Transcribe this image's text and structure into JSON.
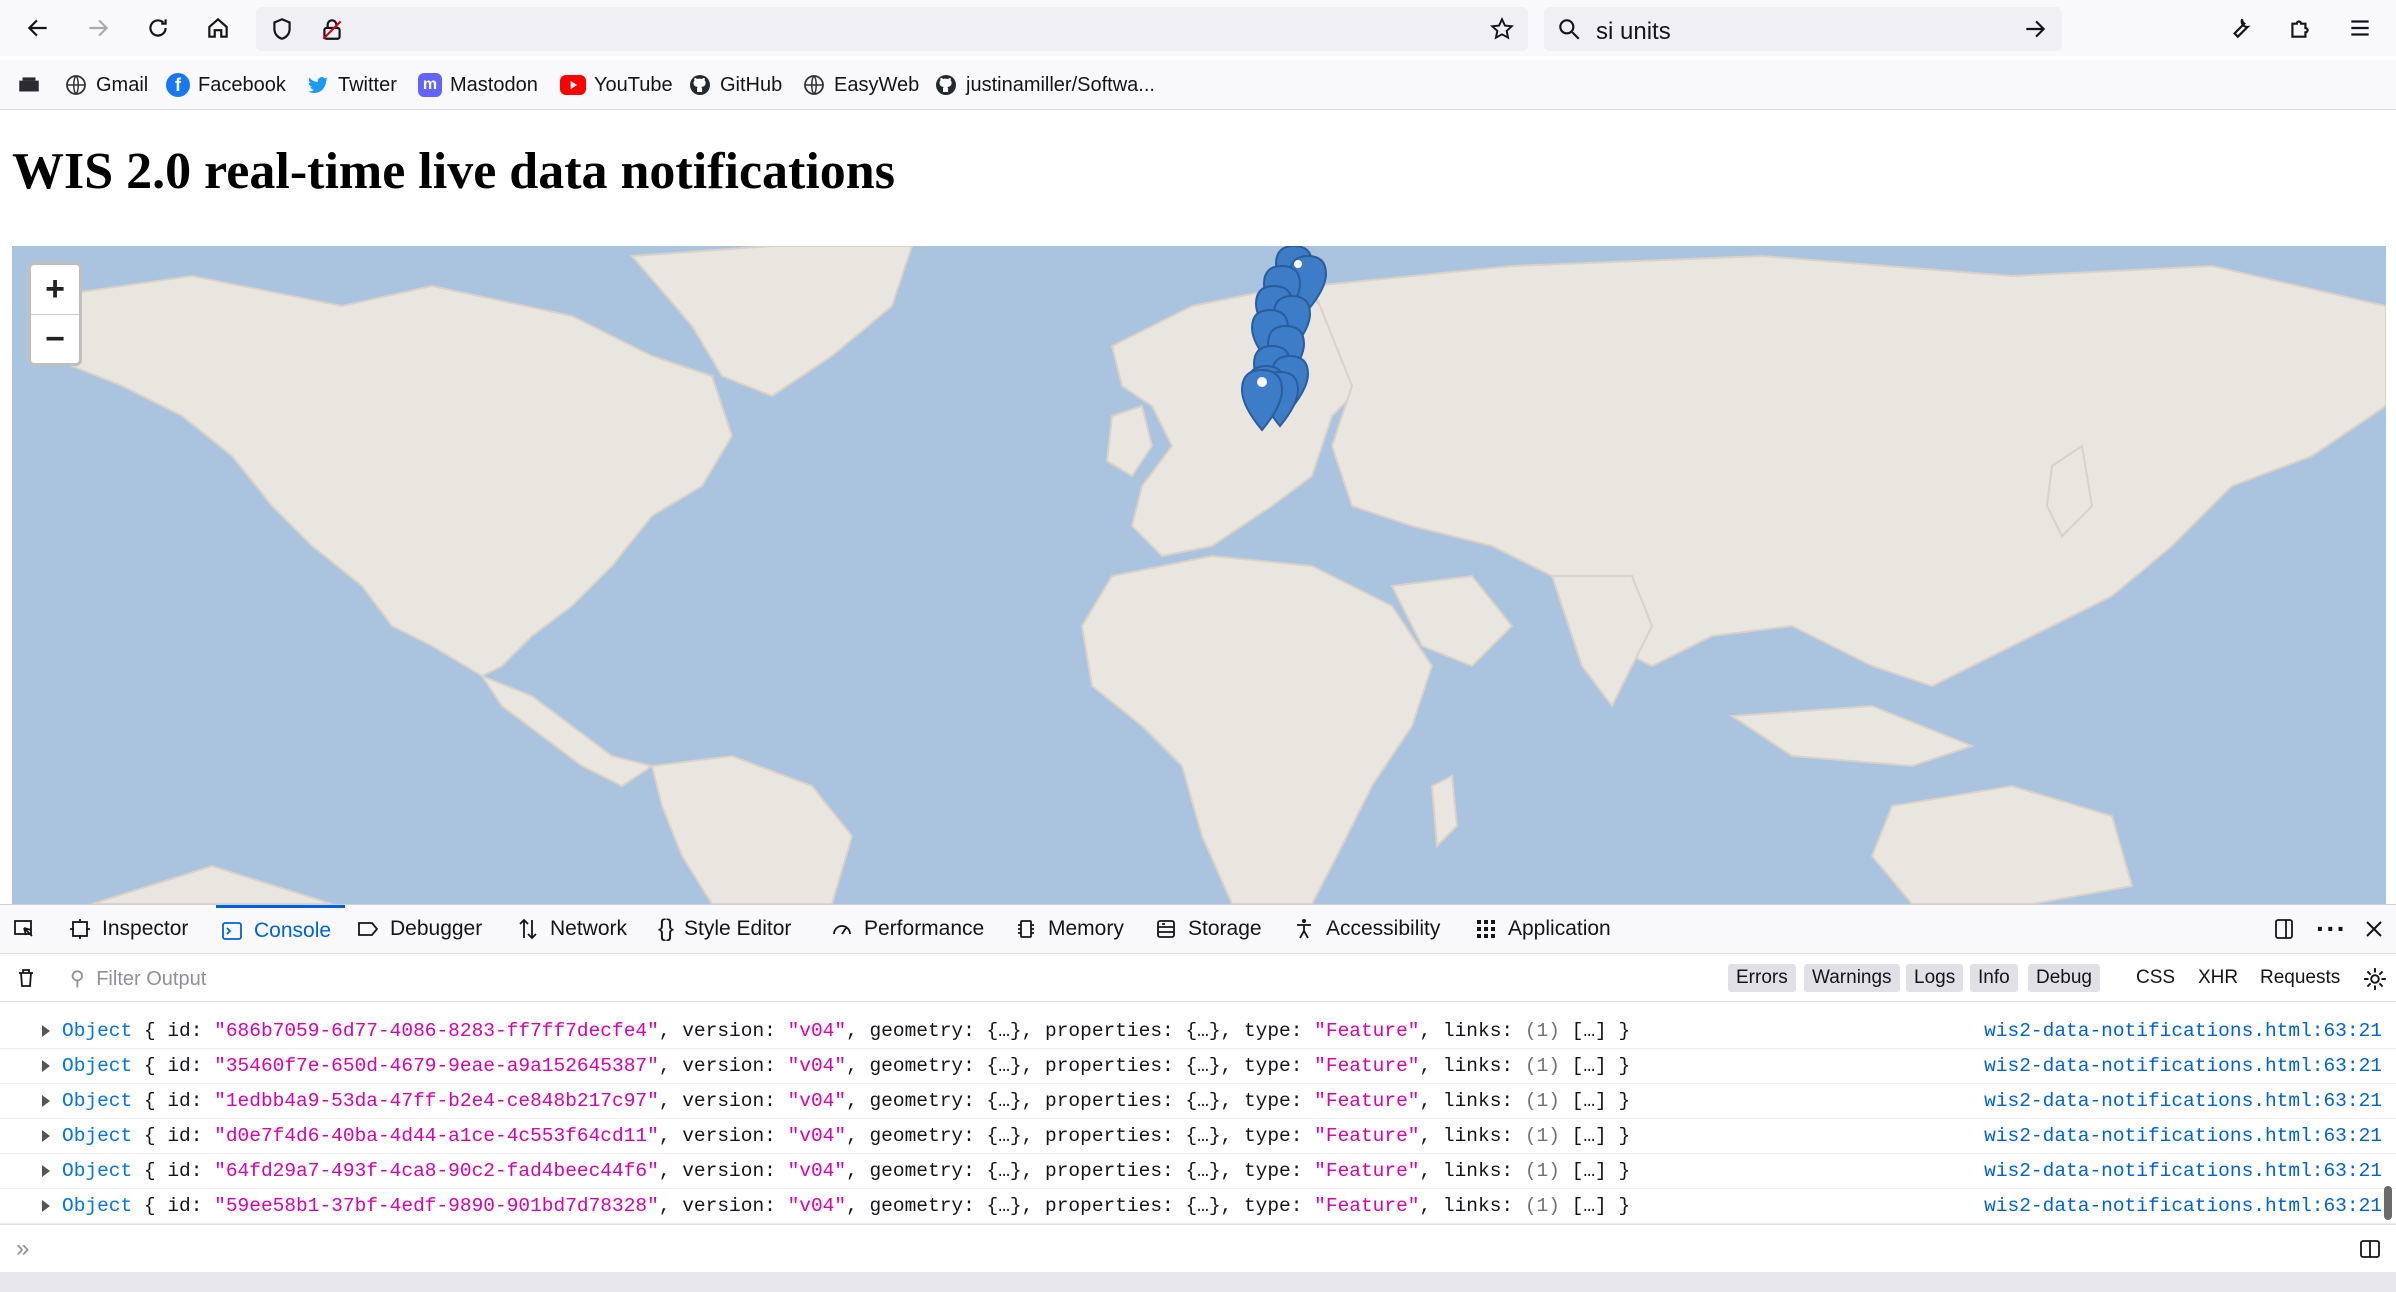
{
  "browser": {
    "url": "",
    "search_text": "si units"
  },
  "bookmarks": [
    {
      "label": "Gmail",
      "icon": "globe-icon"
    },
    {
      "label": "Facebook",
      "icon": "facebook-icon"
    },
    {
      "label": "Twitter",
      "icon": "twitter-icon"
    },
    {
      "label": "Mastodon",
      "icon": "mastodon-icon"
    },
    {
      "label": "YouTube",
      "icon": "youtube-icon"
    },
    {
      "label": "GitHub",
      "icon": "github-icon"
    },
    {
      "label": "EasyWeb",
      "icon": "globe-icon"
    },
    {
      "label": "justinamiller/Softwa...",
      "icon": "github-icon"
    }
  ],
  "page": {
    "title": "WIS 2.0 real-time live data notifications"
  },
  "map": {
    "zoom_in": "+",
    "zoom_out": "−",
    "colors": {
      "ocean": "#aac3df",
      "land": "#e9e5df",
      "marker": "#3d7cc7"
    }
  },
  "devtools": {
    "tabs": [
      {
        "label": "Inspector",
        "icon": "inspector-icon"
      },
      {
        "label": "Console",
        "icon": "console-icon",
        "selected": true
      },
      {
        "label": "Debugger",
        "icon": "debugger-icon"
      },
      {
        "label": "Network",
        "icon": "network-icon"
      },
      {
        "label": "Style Editor",
        "icon": "braces-icon"
      },
      {
        "label": "Performance",
        "icon": "gauge-icon"
      },
      {
        "label": "Memory",
        "icon": "memory-icon"
      },
      {
        "label": "Storage",
        "icon": "storage-icon"
      },
      {
        "label": "Accessibility",
        "icon": "accessibility-icon"
      },
      {
        "label": "Application",
        "icon": "grid-icon"
      }
    ],
    "filter_placeholder": "Filter Output",
    "levels": [
      {
        "label": "Errors"
      },
      {
        "label": "Warnings"
      },
      {
        "label": "Logs"
      },
      {
        "label": "Info"
      },
      {
        "label": "Debug"
      },
      {
        "label": "CSS"
      },
      {
        "label": "XHR"
      },
      {
        "label": "Requests"
      }
    ],
    "logs": [
      {
        "id": "686b7059-6d77-4086-8283-ff7ff7decfe4",
        "source": "wis2-data-notifications.html:63:21"
      },
      {
        "id": "35460f7e-650d-4679-9eae-a9a152645387",
        "source": "wis2-data-notifications.html:63:21"
      },
      {
        "id": "1edbb4a9-53da-47ff-b2e4-ce848b217c97",
        "source": "wis2-data-notifications.html:63:21"
      },
      {
        "id": "d0e7f4d6-40ba-4d44-a1ce-4c553f64cd11",
        "source": "wis2-data-notifications.html:63:21"
      },
      {
        "id": "64fd29a7-493f-4ca8-90c2-fad4beec44f6",
        "source": "wis2-data-notifications.html:63:21"
      },
      {
        "id": "59ee58b1-37bf-4edf-9890-901bd7d78328",
        "source": "wis2-data-notifications.html:63:21"
      }
    ],
    "log_template": {
      "prefix": "Object",
      "id_key": "id:",
      "version_key": "version:",
      "version_val": "\"v04\"",
      "geometry": "geometry: {…}",
      "properties": "properties: {…}",
      "type_key": "type:",
      "type_val": "\"Feature\"",
      "links_key": "links:",
      "links_count": "(1)",
      "links_arr": "[…] }"
    },
    "input_prompt": "»"
  }
}
